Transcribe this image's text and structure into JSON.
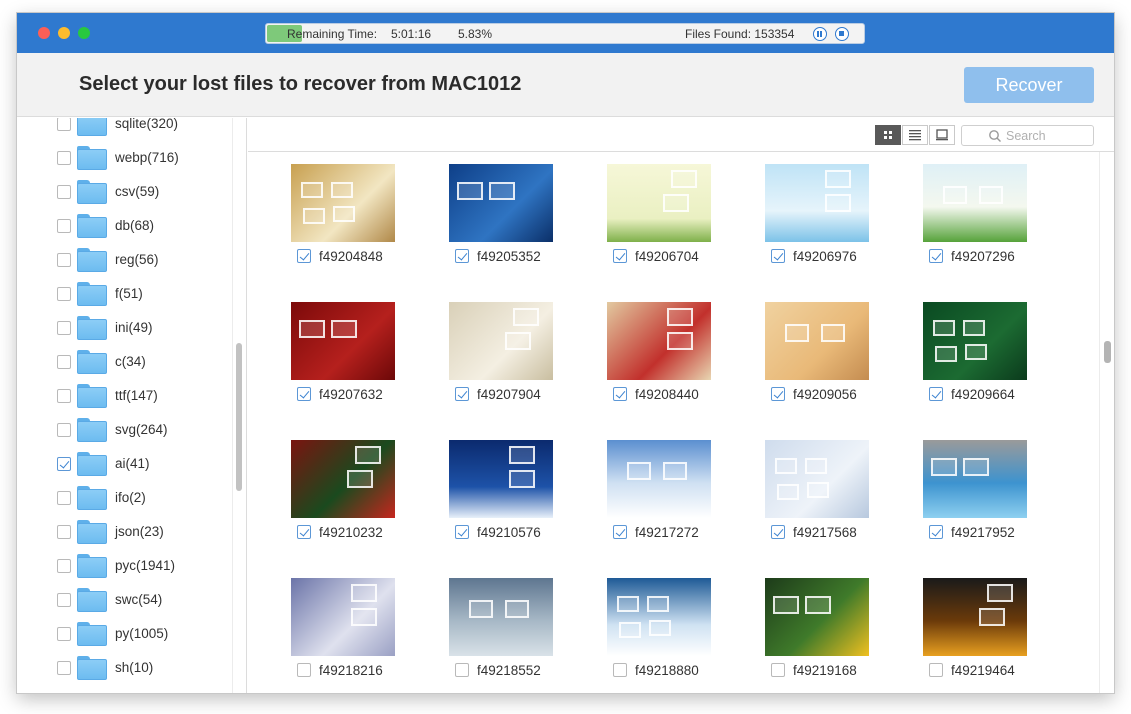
{
  "titlebar": {
    "remaining_label": "Remaining Time:",
    "remaining_value": "5:01:16",
    "percent": "5.83%",
    "progress_fraction": 0.0583,
    "files_found": "Files Found: 153354"
  },
  "header": {
    "title": "Select your lost files to recover from MAC1012",
    "recover_label": "Recover"
  },
  "search": {
    "placeholder": "Search"
  },
  "sidebar": {
    "items": [
      {
        "label": "sqlite(320)",
        "checked": false
      },
      {
        "label": "webp(716)",
        "checked": false
      },
      {
        "label": "csv(59)",
        "checked": false
      },
      {
        "label": "db(68)",
        "checked": false
      },
      {
        "label": "reg(56)",
        "checked": false
      },
      {
        "label": "f(51)",
        "checked": false
      },
      {
        "label": "ini(49)",
        "checked": false
      },
      {
        "label": "c(34)",
        "checked": false
      },
      {
        "label": "ttf(147)",
        "checked": false
      },
      {
        "label": "svg(264)",
        "checked": false
      },
      {
        "label": "ai(41)",
        "checked": true
      },
      {
        "label": "ifo(2)",
        "checked": false
      },
      {
        "label": "json(23)",
        "checked": false
      },
      {
        "label": "pyc(1941)",
        "checked": false
      },
      {
        "label": "swc(54)",
        "checked": false
      },
      {
        "label": "py(1005)",
        "checked": false
      },
      {
        "label": "sh(10)",
        "checked": false
      }
    ]
  },
  "files": [
    {
      "name": "f49204848",
      "checked": true,
      "bg": "linear-gradient(135deg,#c8a050,#f2e6c2 60%,#b08848)"
    },
    {
      "name": "f49205352",
      "checked": true,
      "bg": "linear-gradient(135deg,#0e3f88,#2f74c2 60%,#0b2f68)"
    },
    {
      "name": "f49206704",
      "checked": true,
      "bg": "linear-gradient(180deg,#f6f7d8,#eaf0c2 70%,#7fb04a)"
    },
    {
      "name": "f49206976",
      "checked": true,
      "bg": "linear-gradient(180deg,#bfe3f6,#e6f4fb 60%,#7cc2e8)"
    },
    {
      "name": "f49207296",
      "checked": true,
      "bg": "linear-gradient(180deg,#dff0f6,#f4f8ef 55%,#56a23a)"
    },
    {
      "name": "f49207632",
      "checked": true,
      "bg": "linear-gradient(135deg,#7c0a0a,#b5201d 60%,#6c0808)"
    },
    {
      "name": "f49207904",
      "checked": true,
      "bg": "linear-gradient(135deg,#d9d0b8,#f4efe2 60%,#c9bea0)"
    },
    {
      "name": "f49208440",
      "checked": true,
      "bg": "linear-gradient(135deg,#e2c9a0,#c2302c 60%,#e8d6b2)"
    },
    {
      "name": "f49209056",
      "checked": true,
      "bg": "linear-gradient(135deg,#f0d2a0,#e9b978 60%,#c48c50)"
    },
    {
      "name": "f49209664",
      "checked": true,
      "bg": "linear-gradient(135deg,#0a4a22,#1c6b32 60%,#0b3a1c)"
    },
    {
      "name": "f49210232",
      "checked": true,
      "bg": "linear-gradient(135deg,#7a1410,#1a4a1e 55%,#c6261e)"
    },
    {
      "name": "f49210576",
      "checked": true,
      "bg": "linear-gradient(180deg,#0b2a6e,#1d52a8 60%,#e8f0fa)"
    },
    {
      "name": "f49217272",
      "checked": true,
      "bg": "linear-gradient(180deg,#5b8fd0,#cfe0f2 55%,#ffffff)"
    },
    {
      "name": "f49217568",
      "checked": true,
      "bg": "linear-gradient(135deg,#cfdced,#eef3f9 60%,#b7c8de)"
    },
    {
      "name": "f49217952",
      "checked": true,
      "bg": "linear-gradient(180deg,#9a9a9a,#3d93cf 55%,#8ed0f0)"
    },
    {
      "name": "f49218216",
      "checked": false,
      "bg": "linear-gradient(135deg,#6b74a8,#dfe1ee 60%,#9aa0c4)"
    },
    {
      "name": "f49218552",
      "checked": false,
      "bg": "linear-gradient(180deg,#5e7690,#a7b8c6 55%,#d9e2e8)"
    },
    {
      "name": "f49218880",
      "checked": false,
      "bg": "linear-gradient(180deg,#1e5a96,#cfe2f2 60%,#ffffff)"
    },
    {
      "name": "f49219168",
      "checked": false,
      "bg": "linear-gradient(135deg,#1d3b1a,#3f7a2a 55%,#f0c020)"
    },
    {
      "name": "f49219464",
      "checked": false,
      "bg": "linear-gradient(180deg,#1a1a1a,#6b3a0a 55%,#e8a020)"
    }
  ]
}
